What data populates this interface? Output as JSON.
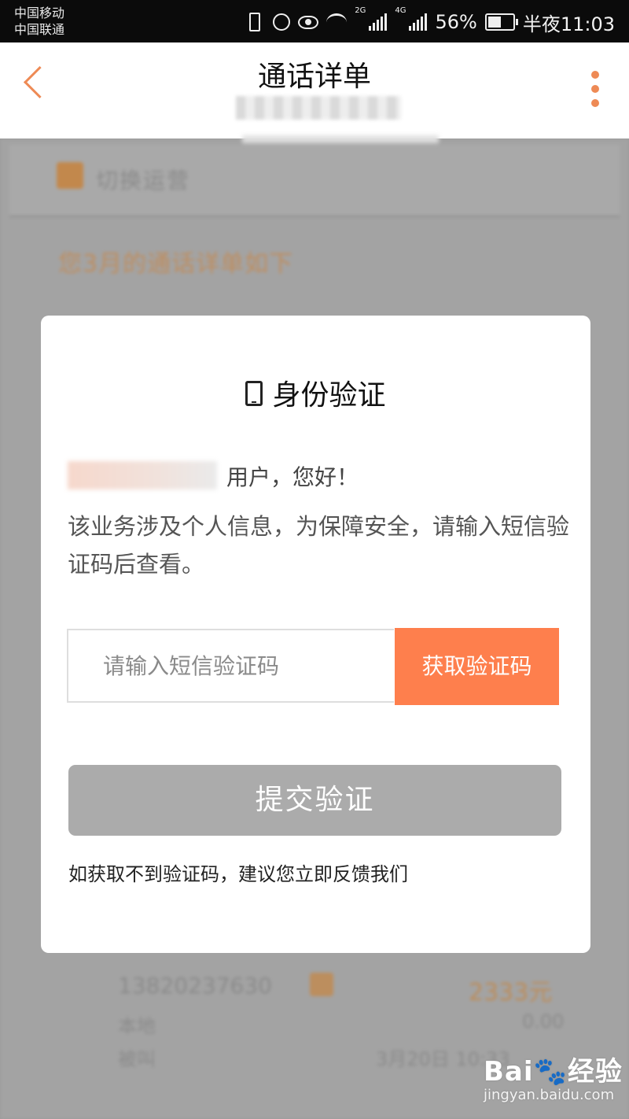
{
  "status_bar": {
    "carrier_1": "中国移动",
    "carrier_2": "中国联通",
    "net_1": "2G",
    "net_2": "4G",
    "battery": "56%",
    "time": "半夜11:03"
  },
  "header": {
    "title": "通话详单",
    "back_icon": "chevron-left-icon",
    "more_icon": "more-vertical-icon",
    "accent_color": "#ee8a55"
  },
  "background": {
    "brand_text": "切换运营",
    "notice": "您3月的通话详单如下",
    "record": {
      "number": "13820237630",
      "amount": "2333元",
      "label_a": "本地",
      "value_a": "0.00",
      "label_b": "被叫",
      "value_b": "3月20日 10:33"
    }
  },
  "dialog": {
    "title": "身份验证",
    "title_icon": "phone-icon",
    "greeting": "用户，您好！",
    "info": "该业务涉及个人信息，为保障安全，请输入短信验证码后查看。",
    "code_placeholder": "请输入短信验证码",
    "get_code_label": "获取验证码",
    "get_code_color": "#fe7f4d",
    "submit_label": "提交验证",
    "submit_color": "#ababab",
    "feedback_text": "如获取不到验证码，建议您立即反馈我们"
  },
  "watermark": {
    "logo": "Bai🐾经验",
    "url": "jingyan.baidu.com"
  }
}
